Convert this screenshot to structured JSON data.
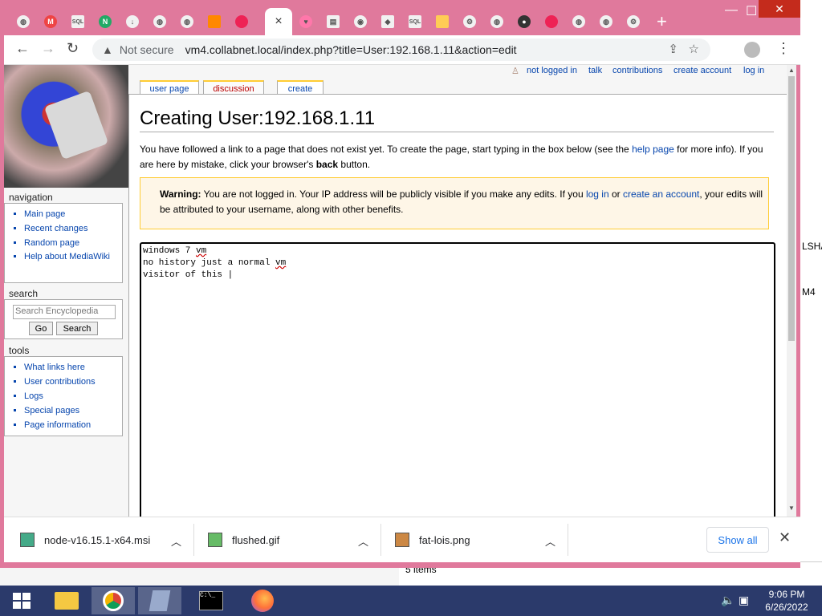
{
  "browser": {
    "tab_count": 22,
    "new_tab_icon": "plus-icon",
    "active_tab_close": "×",
    "window_controls": {
      "minimize": "—",
      "maximize": "☐",
      "close": "✕"
    },
    "url_security": "Not secure",
    "url": "vm4.collabnet.local/index.php?title=User:192.168.1.11&action=edit"
  },
  "wiki": {
    "personal_tools": {
      "user": "not logged in",
      "talk": "talk",
      "contributions": "contributions",
      "create_account": "create account",
      "log_in": "log in"
    },
    "tabs": {
      "user_page": "user page",
      "discussion": "discussion",
      "create": "create"
    },
    "sidebar": {
      "navigation_heading": "navigation",
      "navigation": [
        "Main page",
        "Recent changes",
        "Random page",
        "Help about MediaWiki"
      ],
      "search_heading": "search",
      "search_placeholder": "Search Encyclopedia",
      "go_button": "Go",
      "search_button": "Search",
      "tools_heading": "tools",
      "tools": [
        "What links here",
        "User contributions",
        "Logs",
        "Special pages",
        "Page information"
      ]
    },
    "title": "Creating User:192.168.1.11",
    "intro": {
      "part1": "You have followed a link to a page that does not exist yet. To create the page, start typing in the box below (see the ",
      "help_link": "help page",
      "part2": " for more info). If you are here by mistake, click your browser's ",
      "back_word": "back",
      "part3": " button."
    },
    "warning": {
      "label": "Warning:",
      "text1": " You are not logged in. Your IP address will be publicly visible if you make any edits. If you ",
      "log_in_link": "log in",
      "or_word": " or ",
      "create_account_link": "create an account",
      "text2": ", your edits will be attributed to your username, along with other benefits."
    },
    "editor": {
      "line1_a": "windows 7 ",
      "line1_b": "vm",
      "line2_a": "no history just a normal ",
      "line2_b": "vm",
      "line3": "visitor of this |"
    }
  },
  "downloads": {
    "items": [
      "node-v16.15.1-x64.msi",
      "flushed.gif",
      "fat-lois.png"
    ],
    "show_all": "Show all",
    "close": "✕"
  },
  "desktop": {
    "right_edge_text_1": "LSHA",
    "right_edge_text_2": "M4",
    "bottom_text": "5 items"
  },
  "taskbar": {
    "time": "9:06 PM",
    "date": "6/26/2022"
  },
  "colors": {
    "browser_frame": "#e0799c",
    "wiki_link": "#0645ad",
    "warning_bg": "#fef6e7",
    "warning_border": "#ffcc33",
    "taskbar": "#2b3a6b"
  }
}
